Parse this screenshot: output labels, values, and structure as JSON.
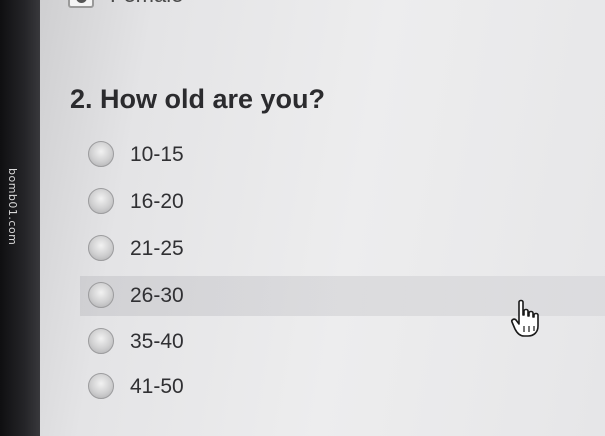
{
  "watermark": "bomb01.com",
  "previous_question": {
    "option_label": "Female"
  },
  "question": {
    "title": "2. How old are you?",
    "options": [
      {
        "label": "10-15"
      },
      {
        "label": "16-20"
      },
      {
        "label": "21-25"
      },
      {
        "label": "26-30"
      },
      {
        "label": "35-40"
      },
      {
        "label": "41-50"
      }
    ]
  },
  "icons": {
    "cursor": "hand-pointer-icon",
    "radio": "radio-button-icon"
  }
}
